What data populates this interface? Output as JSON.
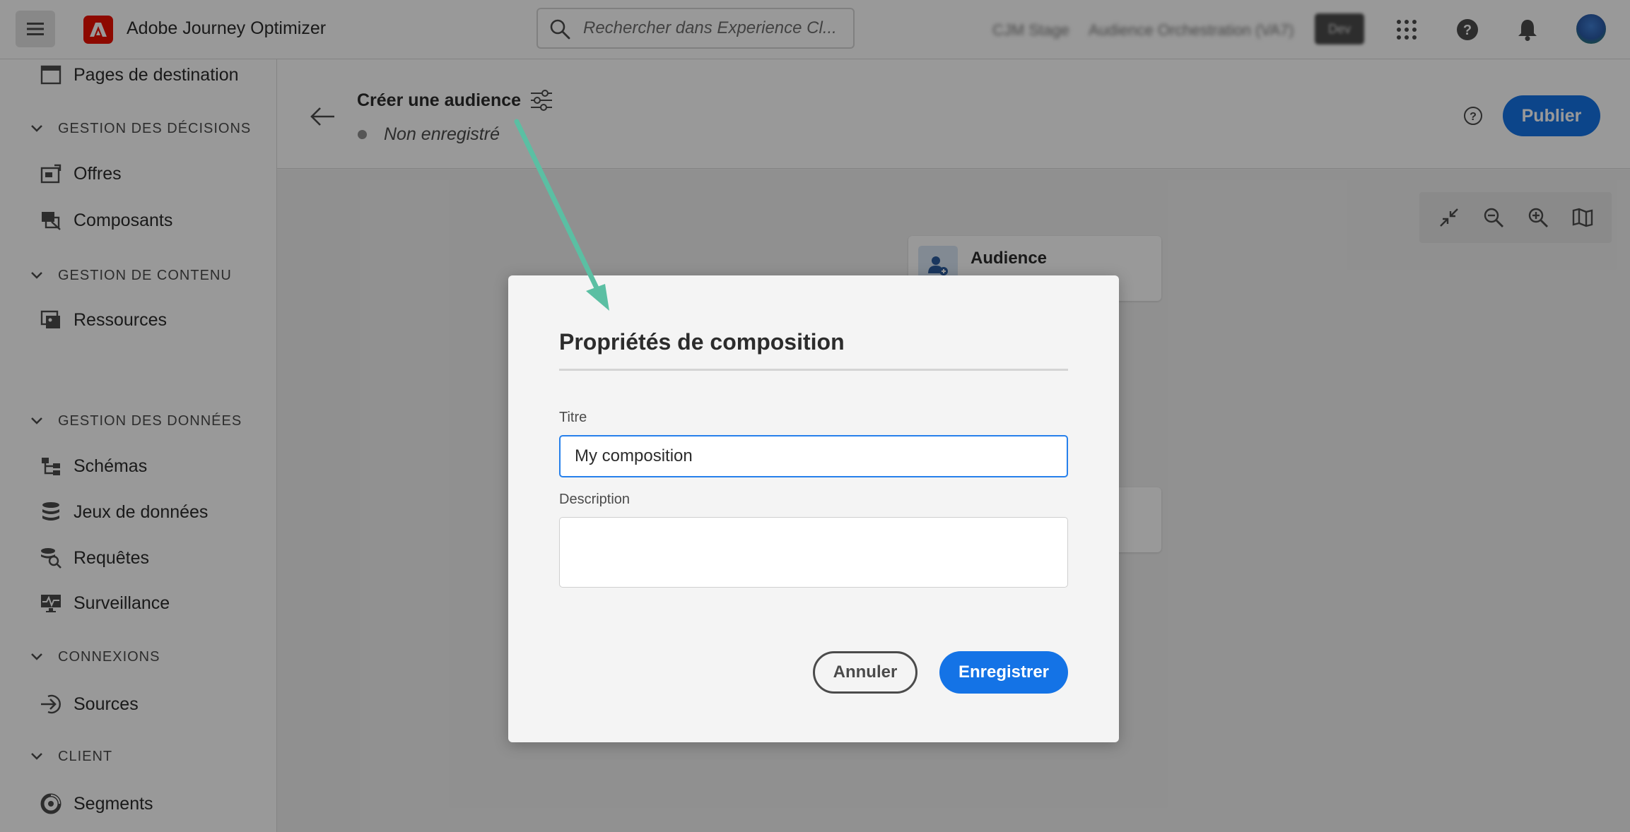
{
  "topbar": {
    "app_title": "Adobe Journey Optimizer",
    "search_placeholder": "Rechercher dans Experience Cl...",
    "org_name": "CJM Stage",
    "sandbox_name": "Audience Orchestration (VA7)",
    "env_badge": "Dev"
  },
  "sidebar": {
    "items": [
      {
        "type": "item",
        "label": "Pages de destination",
        "icon": "page-icon"
      },
      {
        "type": "section",
        "label": "GESTION DES DÉCISIONS"
      },
      {
        "type": "item",
        "label": "Offres",
        "icon": "offers-icon"
      },
      {
        "type": "item",
        "label": "Composants",
        "icon": "components-icon"
      },
      {
        "type": "section",
        "label": "GESTION DE CONTENU"
      },
      {
        "type": "item",
        "label": "Ressources",
        "icon": "assets-icon"
      },
      {
        "type": "section",
        "label": "GESTION DES DONNÉES"
      },
      {
        "type": "item",
        "label": "Schémas",
        "icon": "schema-icon"
      },
      {
        "type": "item",
        "label": "Jeux de données",
        "icon": "datasets-icon"
      },
      {
        "type": "item",
        "label": "Requêtes",
        "icon": "queries-icon"
      },
      {
        "type": "item",
        "label": "Surveillance",
        "icon": "monitoring-icon"
      },
      {
        "type": "section",
        "label": "CONNEXIONS"
      },
      {
        "type": "item",
        "label": "Sources",
        "icon": "sources-icon"
      },
      {
        "type": "section",
        "label": "CLIENT"
      },
      {
        "type": "item",
        "label": "Segments",
        "icon": "segments-icon"
      }
    ]
  },
  "header": {
    "title": "Créer une audience",
    "status": "Non enregistré",
    "publish_label": "Publier"
  },
  "canvas": {
    "audience_node_label": "Audience"
  },
  "modal": {
    "title": "Propriétés de composition",
    "title_field_label": "Titre",
    "title_field_value": "My composition",
    "description_field_label": "Description",
    "description_field_value": "",
    "cancel_label": "Annuler",
    "save_label": "Enregistrer"
  },
  "colors": {
    "accent": "#1473e6",
    "annotation_arrow": "#5bbfa3",
    "brand": "#eb1000"
  }
}
